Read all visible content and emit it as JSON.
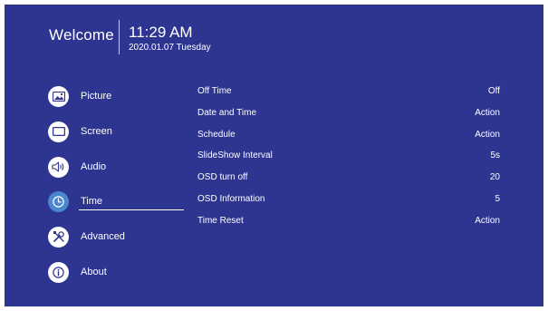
{
  "header": {
    "greeting": "Welcome",
    "time": "11:29 AM",
    "date": "2020.01.07 Tuesday"
  },
  "colors": {
    "background": "#2d3591",
    "active_icon": "#4b86cf",
    "text": "#ffffff"
  },
  "nav": {
    "selected": "Time",
    "items": [
      {
        "label": "Picture",
        "icon": "picture-icon"
      },
      {
        "label": "Screen",
        "icon": "screen-icon"
      },
      {
        "label": "Audio",
        "icon": "speaker-icon"
      },
      {
        "label": "Time",
        "icon": "clock-icon"
      },
      {
        "label": "Advanced",
        "icon": "tools-icon"
      },
      {
        "label": "About",
        "icon": "info-icon"
      }
    ]
  },
  "settings": [
    {
      "label": "Off Time",
      "value": "Off"
    },
    {
      "label": "Date and Time",
      "value": "Action"
    },
    {
      "label": "Schedule",
      "value": "Action"
    },
    {
      "label": "SlideShow Interval",
      "value": "5s"
    },
    {
      "label": "OSD turn off",
      "value": "20"
    },
    {
      "label": "OSD Information",
      "value": "5"
    },
    {
      "label": "Time Reset",
      "value": "Action"
    }
  ]
}
